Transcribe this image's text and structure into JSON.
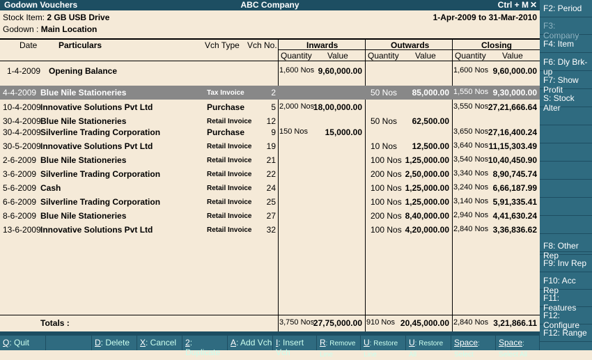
{
  "titlebar": {
    "report": "Godown Vouchers",
    "company": "ABC Company",
    "shortcut": "Ctrl + M",
    "close": "✕"
  },
  "info": {
    "stock_item_label": "Stock Item:",
    "stock_item": "2 GB USB Drive",
    "godown_label": "Godown :",
    "godown": "Main Location",
    "period": "1-Apr-2009 to 31-Mar-2010"
  },
  "headers": {
    "date": "Date",
    "particulars": "Particulars",
    "vch_type": "Vch Type",
    "vch_no": "Vch No.",
    "inwards": "Inwards",
    "outwards": "Outwards",
    "closing": "Closing",
    "quantity": "Quantity",
    "value": "Value"
  },
  "rows": [
    {
      "date": "1-4-2009",
      "particulars": "Opening Balance",
      "vch_type": "",
      "vch_no": "",
      "in_qty": "1,600 Nos",
      "in_val": "9,60,000.00",
      "out_qty": "",
      "out_val": "",
      "cl_qty": "1,600 Nos",
      "cl_val": "9,60,000.00"
    },
    {
      "date": "4-4-2009",
      "particulars": "Blue Nile Stationeries",
      "vch_type": "Tax Invoice",
      "vch_no": "2",
      "in_qty": "",
      "in_val": "",
      "out_qty": "50 Nos",
      "out_val": "85,000.00",
      "cl_qty": "1,550 Nos",
      "cl_val": "9,30,000.00"
    },
    {
      "date": "10-4-2009",
      "particulars": "Innovative Solutions Pvt Ltd",
      "vch_type": "Purchase",
      "vch_no": "5",
      "in_qty": "2,000 Nos",
      "in_val": "18,00,000.00",
      "out_qty": "",
      "out_val": "",
      "cl_qty": "3,550 Nos",
      "cl_val": "27,21,666.64"
    },
    {
      "date": "30-4-2009",
      "particulars": "Blue Nile Stationeries",
      "vch_type": "Retail Invoice",
      "vch_no": "12",
      "in_qty": "",
      "in_val": "",
      "out_qty": "50 Nos",
      "out_val": "62,500.00",
      "cl_qty": "",
      "cl_val": ""
    },
    {
      "date": "30-4-2009",
      "particulars": "Silverline Trading Corporation",
      "vch_type": "Purchase",
      "vch_no": "9",
      "in_qty": "150 Nos",
      "in_val": "15,000.00",
      "out_qty": "",
      "out_val": "",
      "cl_qty": "3,650 Nos",
      "cl_val": "27,16,400.24"
    },
    {
      "date": "30-5-2009",
      "particulars": "Innovative Solutions Pvt Ltd",
      "vch_type": "Retail Invoice",
      "vch_no": "19",
      "in_qty": "",
      "in_val": "",
      "out_qty": "10 Nos",
      "out_val": "12,500.00",
      "cl_qty": "3,640 Nos",
      "cl_val": "11,15,303.49"
    },
    {
      "date": "2-6-2009",
      "particulars": "Blue Nile Stationeries",
      "vch_type": "Retail Invoice",
      "vch_no": "21",
      "in_qty": "",
      "in_val": "",
      "out_qty": "100 Nos",
      "out_val": "1,25,000.00",
      "cl_qty": "3,540 Nos",
      "cl_val": "10,40,450.90"
    },
    {
      "date": "3-6-2009",
      "particulars": "Silverline Trading Corporation",
      "vch_type": "Retail Invoice",
      "vch_no": "22",
      "in_qty": "",
      "in_val": "",
      "out_qty": "200 Nos",
      "out_val": "2,50,000.00",
      "cl_qty": "3,340 Nos",
      "cl_val": "8,90,745.74"
    },
    {
      "date": "5-6-2009",
      "particulars": "Cash",
      "vch_type": "Retail Invoice",
      "vch_no": "24",
      "in_qty": "",
      "in_val": "",
      "out_qty": "100 Nos",
      "out_val": "1,25,000.00",
      "cl_qty": "3,240 Nos",
      "cl_val": "6,66,187.99"
    },
    {
      "date": "6-6-2009",
      "particulars": "Silverline Trading Corporation",
      "vch_type": "Retail Invoice",
      "vch_no": "25",
      "in_qty": "",
      "in_val": "",
      "out_qty": "100 Nos",
      "out_val": "1,25,000.00",
      "cl_qty": "3,140 Nos",
      "cl_val": "5,91,335.41"
    },
    {
      "date": "8-6-2009",
      "particulars": "Blue Nile Stationeries",
      "vch_type": "Retail Invoice",
      "vch_no": "27",
      "in_qty": "",
      "in_val": "",
      "out_qty": "200 Nos",
      "out_val": "8,40,000.00",
      "cl_qty": "2,940 Nos",
      "cl_val": "4,41,630.24"
    },
    {
      "date": "13-6-2009",
      "particulars": "Innovative Solutions Pvt Ltd",
      "vch_type": "Retail Invoice",
      "vch_no": "32",
      "in_qty": "",
      "in_val": "",
      "out_qty": "100 Nos",
      "out_val": "4,20,000.00",
      "cl_qty": "2,840 Nos",
      "cl_val": "3,36,836.62"
    }
  ],
  "totals": {
    "label": "Totals :",
    "in_qty": "3,750 Nos",
    "in_val": "27,75,000.00",
    "out_qty": "910 Nos",
    "out_val": "20,45,000.00",
    "cl_qty": "2,840 Nos",
    "cl_val": "3,21,866.11"
  },
  "bottom_buttons": [
    {
      "key": "Q",
      "label": ": Quit"
    },
    {
      "key": "",
      "label": ""
    },
    {
      "key": "D",
      "label": ": Delete"
    },
    {
      "key": "X",
      "label": ": Cancel"
    },
    {
      "key": "2",
      "label": ": Duplicate"
    },
    {
      "key": "A",
      "label": ": Add Vch"
    },
    {
      "key": "I",
      "label": ": Insert Vch"
    },
    {
      "key": "R",
      "label": ": Remove Line"
    },
    {
      "key": "U",
      "label": ": Restore Line"
    },
    {
      "key": "U",
      "label": ": Restore All"
    },
    {
      "key": "Space",
      "label": ": Select"
    },
    {
      "key": "Space",
      "label": ": Select All"
    }
  ],
  "right_buttons": [
    {
      "label": "F2: Period"
    },
    {
      "label": "F3: Company"
    },
    {
      "label": "F4: Item"
    },
    {
      "label": "F6: Dly Brk-up"
    },
    {
      "label": "F7: Show Profit"
    },
    {
      "label": "S: Stock Alter"
    },
    {
      "label": "F8: Other Rep"
    },
    {
      "label": "F9: Inv Rep"
    },
    {
      "label": "F10: Acc Rep"
    },
    {
      "label": "F11: Features"
    },
    {
      "label": "F12: Configure"
    },
    {
      "label": "F12: Range"
    }
  ]
}
